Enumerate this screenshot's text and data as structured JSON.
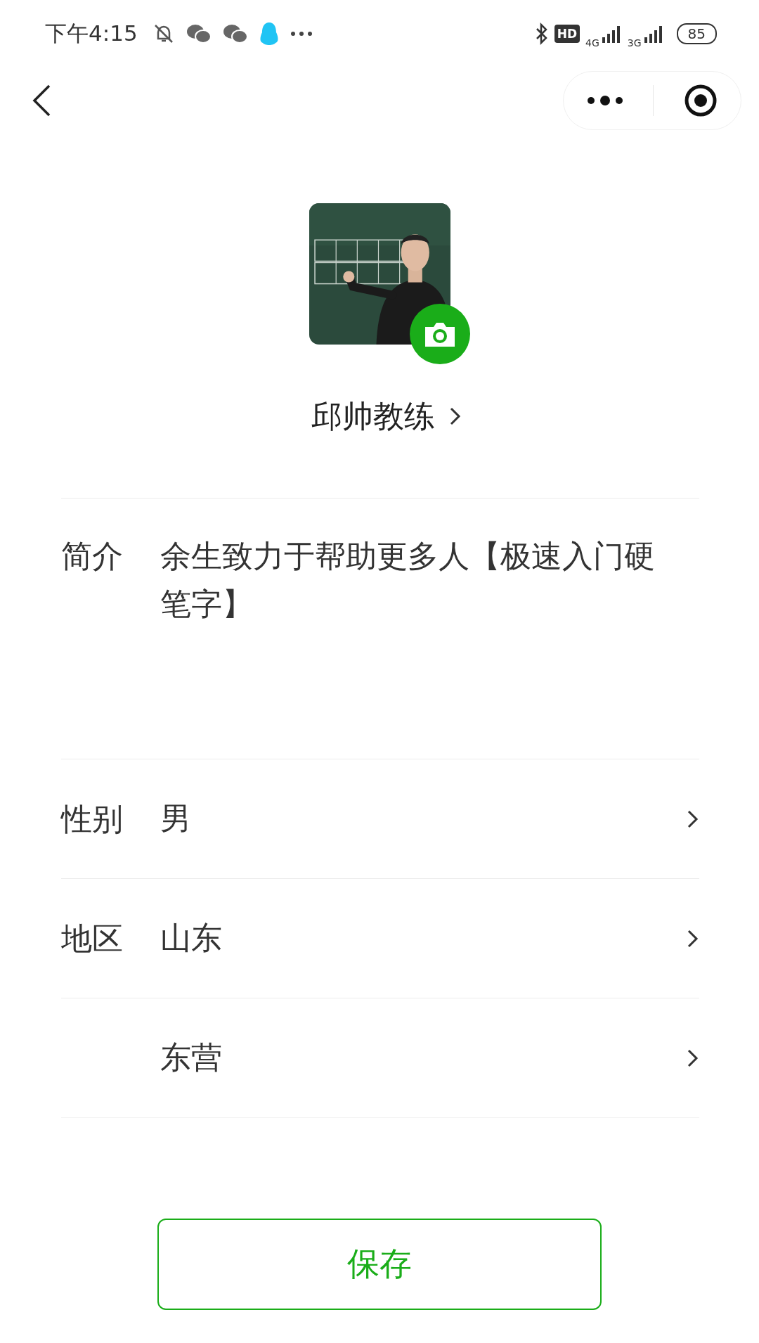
{
  "status_bar": {
    "time": "下午4:15",
    "hd": "HD",
    "network_1": "4G",
    "network_2": "3G",
    "battery": "85"
  },
  "profile": {
    "name": "邱帅教练"
  },
  "intro": {
    "label": "简介",
    "value": "余生致力于帮助更多人【极速入门硬笔字】"
  },
  "gender": {
    "label": "性别",
    "value": "男"
  },
  "region": {
    "label": "地区",
    "values": [
      "山东",
      "东营"
    ]
  },
  "save_button": {
    "label": "保存"
  }
}
